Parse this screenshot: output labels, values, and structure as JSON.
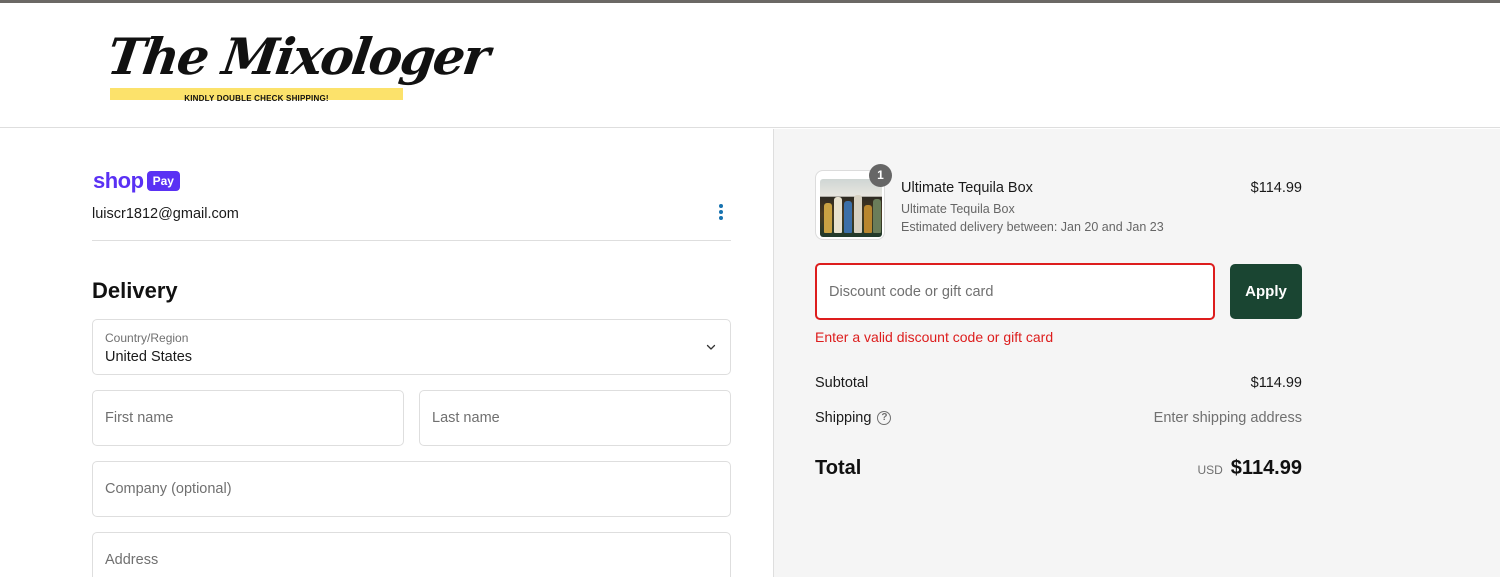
{
  "header": {
    "logo_text": "The Mixologer",
    "logo_tagline": "KINDLY DOUBLE CHECK SHIPPING!"
  },
  "account": {
    "shop_word": "shop",
    "pay_badge": "Pay",
    "email": "luiscr1812@gmail.com",
    "menu_icon": "more-vertical-icon"
  },
  "delivery": {
    "title": "Delivery",
    "country_label": "Country/Region",
    "country_value": "United States",
    "first_name_placeholder": "First name",
    "last_name_placeholder": "Last name",
    "company_placeholder": "Company (optional)",
    "address_placeholder": "Address"
  },
  "order": {
    "item": {
      "name": "Ultimate Tequila Box",
      "variant": "Ultimate Tequila Box",
      "eta": "Estimated delivery between: Jan 20 and Jan 23",
      "price": "$114.99",
      "quantity": "1"
    },
    "discount_placeholder": "Discount code or gift card",
    "apply_label": "Apply",
    "error_text": "Enter a valid discount code or gift card",
    "subtotal_label": "Subtotal",
    "subtotal_value": "$114.99",
    "shipping_label": "Shipping",
    "shipping_help_icon": "question-circle-icon",
    "shipping_value": "Enter shipping address",
    "total_label": "Total",
    "currency": "USD",
    "total_value": "$114.99"
  },
  "colors": {
    "shop_pay": "#5a31f4",
    "apply_button": "#1a4532",
    "error": "#dd1d1d",
    "link": "#1773b0",
    "logo_band": "#fce26b"
  }
}
